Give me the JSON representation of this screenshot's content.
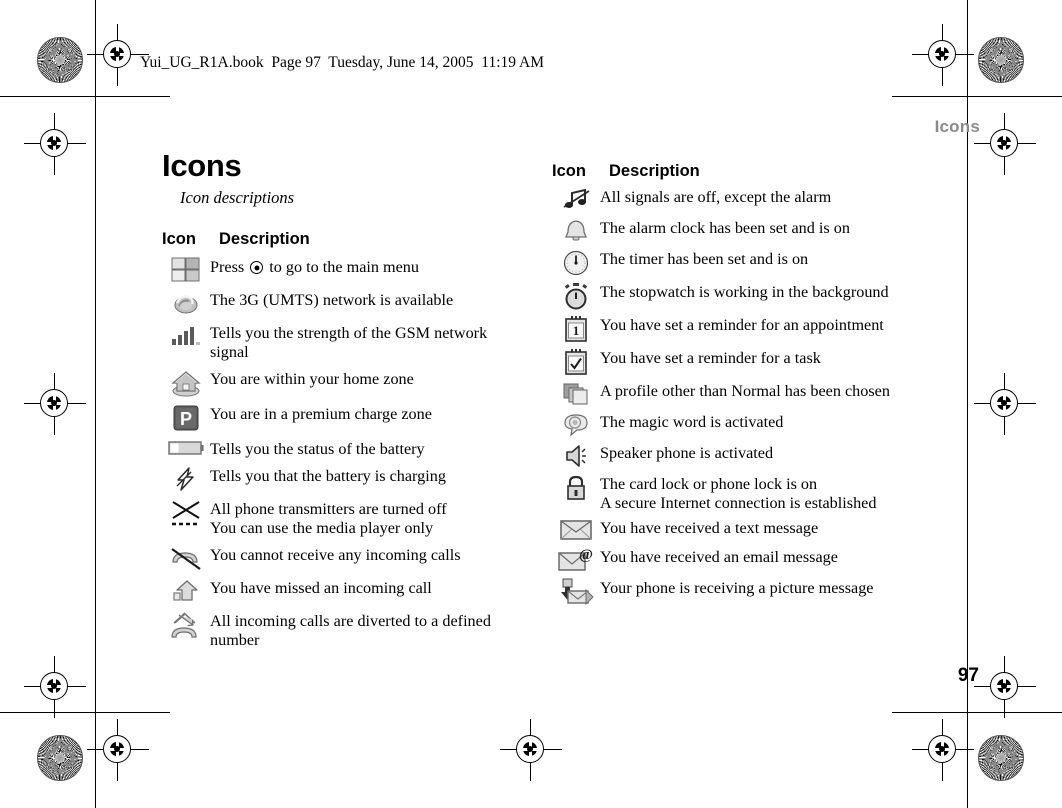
{
  "slug": {
    "text": "Yui_UG_R1A.book  Page 97  Tuesday, June 14, 2005  11:19 AM"
  },
  "running_head": "Icons",
  "page_number": "97",
  "title": "Icons",
  "subtitle": "Icon descriptions",
  "columns": {
    "left": {
      "header": {
        "icon": "Icon",
        "description": "Description"
      },
      "rows": [
        {
          "icon_name": "main-menu-grid-icon",
          "desc_pre": "Press",
          "desc_post": "to go to the main menu",
          "has_joystick": true
        },
        {
          "icon_name": "3g-umts-network-icon",
          "desc": "The 3G (UMTS) network is available"
        },
        {
          "icon_name": "gsm-signal-strength-icon",
          "desc": "Tells you the strength of the GSM network",
          "desc2": "signal"
        },
        {
          "icon_name": "home-zone-icon",
          "desc": "You are within your home zone"
        },
        {
          "icon_name": "premium-charge-zone-icon",
          "desc": "You are in a premium charge zone"
        },
        {
          "icon_name": "battery-status-icon",
          "desc": "Tells you the status of the battery"
        },
        {
          "icon_name": "battery-charging-icon",
          "desc": "Tells you that the battery is charging"
        },
        {
          "icon_name": "flight-mode-icon",
          "desc": "All phone transmitters are turned off",
          "desc2": "You can use the media player only"
        },
        {
          "icon_name": "no-incoming-calls-icon",
          "desc": "You cannot receive any incoming calls"
        },
        {
          "icon_name": "missed-call-icon",
          "desc": "You have missed an incoming call"
        },
        {
          "icon_name": "call-divert-icon",
          "desc": "All incoming calls are diverted to a defined",
          "desc2": "number"
        }
      ]
    },
    "right": {
      "header": {
        "icon": "Icon",
        "description": "Description"
      },
      "rows": [
        {
          "icon_name": "silent-mode-icon",
          "desc": "All signals are off, except the alarm"
        },
        {
          "icon_name": "alarm-clock-icon",
          "desc": "The alarm clock has been set and is on"
        },
        {
          "icon_name": "timer-icon",
          "desc": "The timer has been set and is on"
        },
        {
          "icon_name": "stopwatch-icon",
          "desc": "The stopwatch is working in the background"
        },
        {
          "icon_name": "appointment-reminder-icon",
          "desc": "You have set a reminder for an appointment"
        },
        {
          "icon_name": "task-reminder-icon",
          "desc": "You have set a reminder for a task"
        },
        {
          "icon_name": "profile-icon",
          "desc": "A profile other than Normal has been chosen"
        },
        {
          "icon_name": "magic-word-icon",
          "desc": "The magic word is activated"
        },
        {
          "icon_name": "speaker-phone-icon",
          "desc": "Speaker phone is activated"
        },
        {
          "icon_name": "lock-icon",
          "desc": "The card lock or phone lock is on",
          "desc2": "A secure Internet connection is established"
        },
        {
          "icon_name": "text-message-icon",
          "desc": "You have received a text message"
        },
        {
          "icon_name": "email-message-icon",
          "desc": "You have received an email message"
        },
        {
          "icon_name": "picture-message-icon",
          "desc": "Your phone is receiving a picture message"
        }
      ]
    }
  },
  "colors": {
    "text": "#000000",
    "running_head": "#8a8a8a",
    "icon_light": "#d4d4d4",
    "icon_mid": "#9a9a9a",
    "icon_dark": "#555555"
  }
}
